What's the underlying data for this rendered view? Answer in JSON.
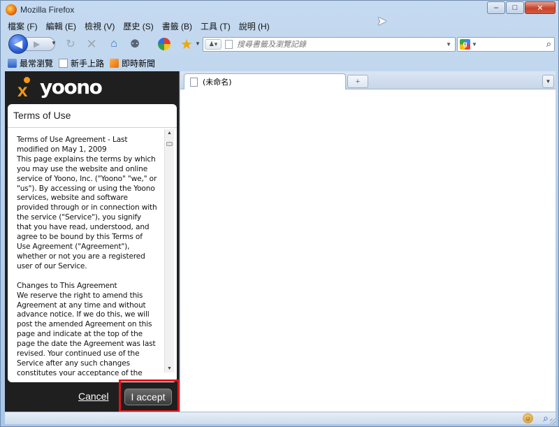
{
  "window": {
    "title": "Mozilla Firefox",
    "controls": {
      "minimize": "–",
      "maximize": "□",
      "close": "✕"
    }
  },
  "menu": [
    "檔案 (F)",
    "編輯 (E)",
    "檢視 (V)",
    "歷史 (S)",
    "書籤 (B)",
    "工具 (T)",
    "說明 (H)"
  ],
  "nav": {
    "back": "◀",
    "forward": "▶",
    "reload": "↻",
    "stop": "✕",
    "home": "⌂",
    "share": "⚉",
    "star": "★",
    "url_placeholder": "搜尋書籤及瀏覽記錄",
    "search_engine": "g",
    "search_go": "⌕"
  },
  "bookmarks": [
    "最常瀏覽",
    "新手上路",
    "即時新聞"
  ],
  "sidebar": {
    "logo_text": "yoono",
    "dialog_title": "Terms of Use",
    "terms_paragraphs": [
      "Terms of Use Agreement - Last modified on May 1, 2009\nThis page explains the terms by which you may use the website and online service of Yoono, Inc. (\"Yoono\" \"we,\" or \"us\"). By accessing or using the Yoono services, website and software provided through or in connection with the service (\"Service\"), you signify that you have read, understood, and agree to be bound by this Terms of Use Agreement (\"Agreement\"), whether or not you are a registered user of our Service.",
      "Changes to This Agreement\nWe reserve the right to amend this Agreement at any time and without advance notice. If we do this, we will post the amended Agreement on this page and indicate at the top of the page the date the Agreement was last revised. Your continued use of the Service after any such changes constitutes your acceptance of the new"
    ],
    "cancel_label": "Cancel",
    "accept_label": "I accept"
  },
  "tabs": [
    {
      "label": "(未命名)"
    }
  ],
  "newtab_label": "+",
  "colors": {
    "highlight": "#e0141b",
    "yoono_orange": "#f39a12",
    "sidebar_bg": "#1f1f1f"
  },
  "status": {
    "yoono_icon": "☺",
    "zoom_icon": "⌕"
  }
}
